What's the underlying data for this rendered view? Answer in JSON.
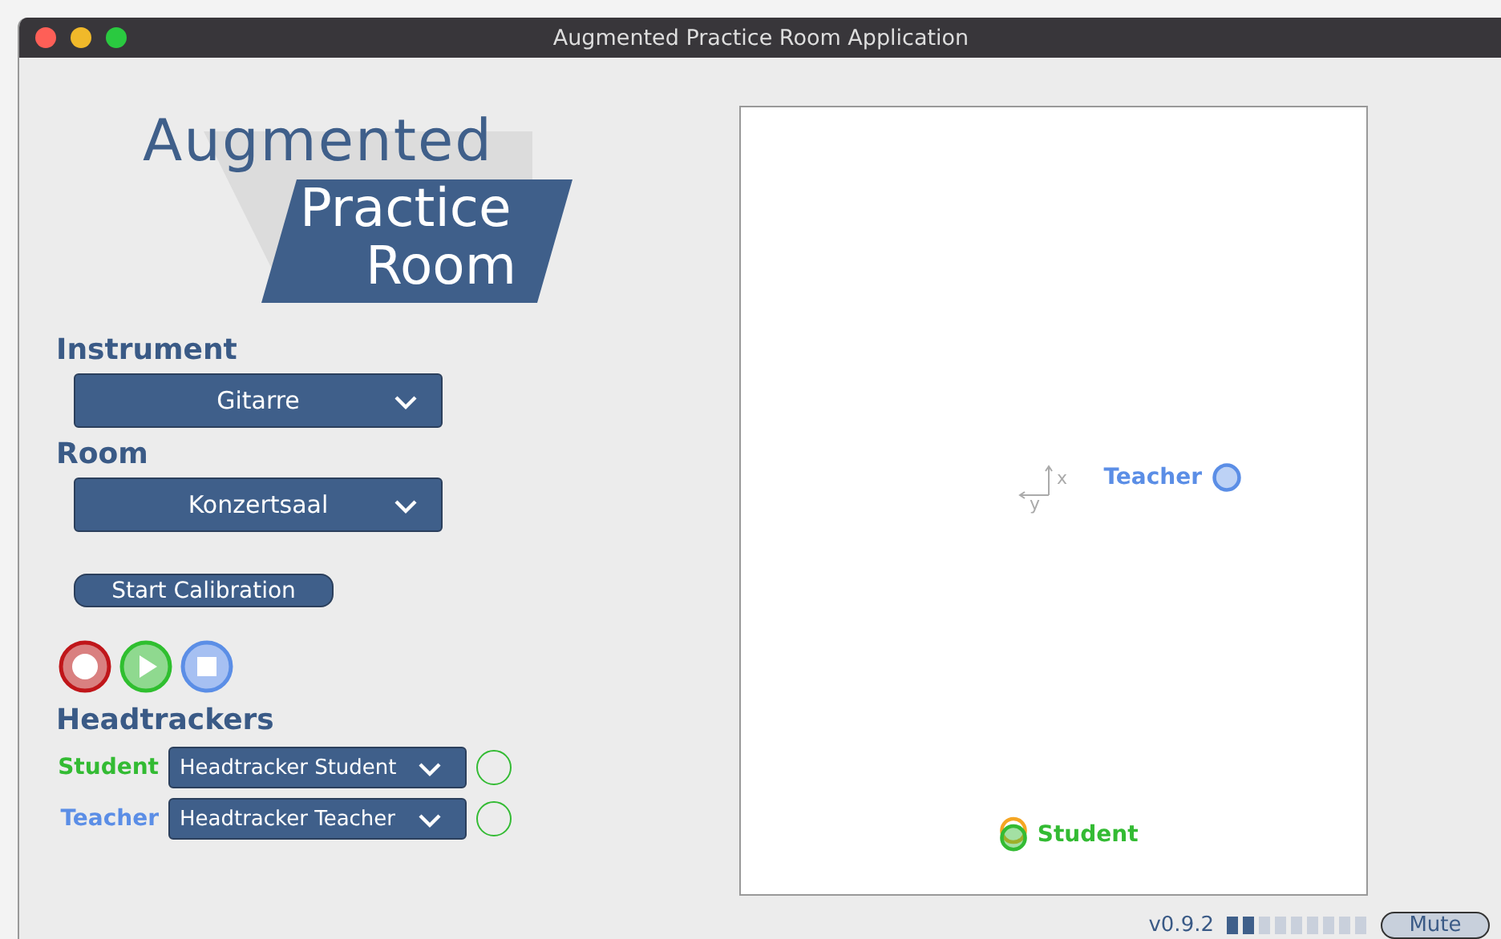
{
  "window": {
    "title": "Augmented Practice Room Application"
  },
  "logo": {
    "line_1": "Augmented",
    "line_2": "Practice",
    "line_3": "Room"
  },
  "instrument": {
    "label": "Instrument",
    "value": "Gitarre"
  },
  "room": {
    "label": "Room",
    "value": "Konzertsaal"
  },
  "calibration_button": "Start Calibration",
  "transport": [
    {
      "kind": "record"
    },
    {
      "kind": "play"
    },
    {
      "kind": "stop"
    }
  ],
  "headtrackers": {
    "title": "Headtrackers",
    "items": [
      {
        "label": "Student",
        "color": "#33bb33",
        "device": "Headtracker Student"
      },
      {
        "label": "Teacher",
        "color": "#5b8ee6",
        "device": "Headtracker Teacher"
      }
    ]
  },
  "canvas": {
    "axis_x": "x",
    "axis_y": "y",
    "markers": [
      {
        "kind": "teacher",
        "label": "Teacher",
        "color": "#5b8ee6"
      },
      {
        "kind": "student",
        "label": "Student",
        "color": "#33bb33"
      }
    ]
  },
  "status_bar": {
    "version": "v0.9.2",
    "meter": {
      "level": 0.22
    },
    "mute_button": "Mute"
  }
}
